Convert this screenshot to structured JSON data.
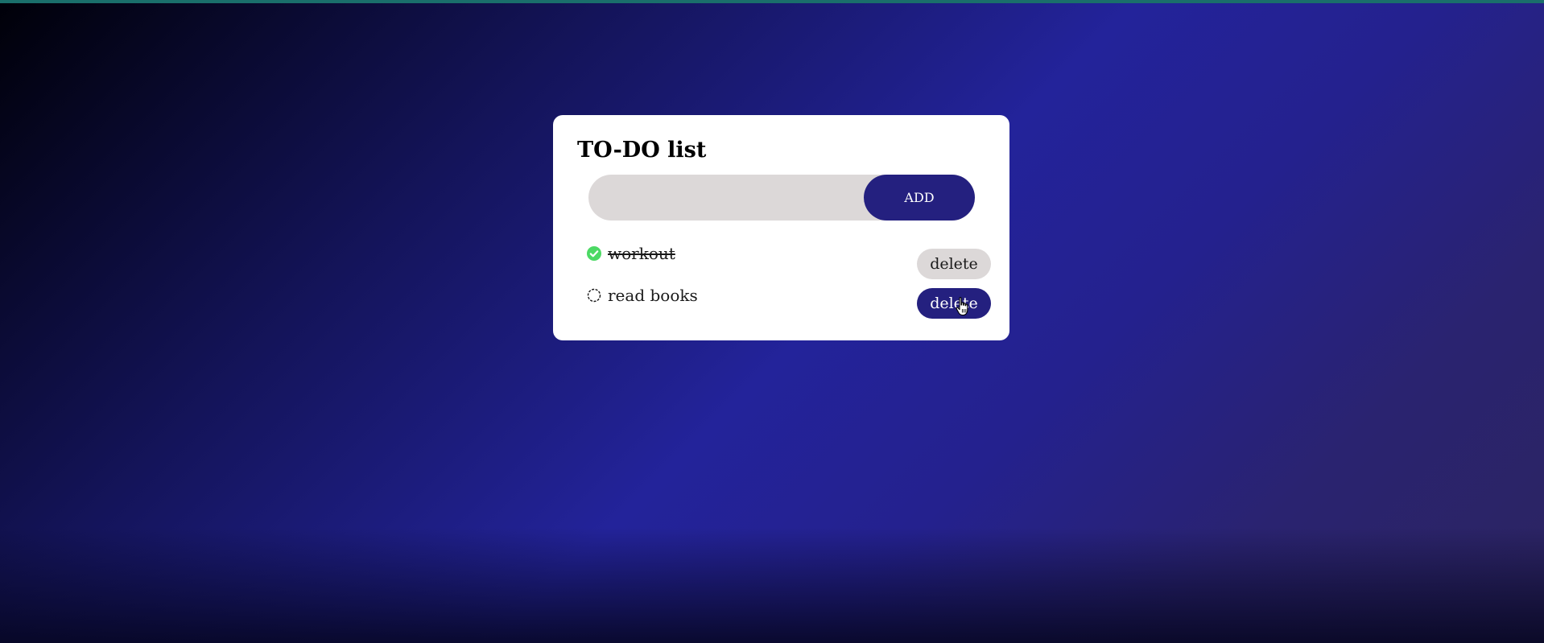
{
  "app": {
    "title": "TO-DO list"
  },
  "add_form": {
    "input_value": "",
    "input_placeholder": "",
    "add_label": "ADD"
  },
  "todos": [
    {
      "text": "workout",
      "done": true,
      "delete_label": "delete",
      "delete_style": "light"
    },
    {
      "text": "read books",
      "done": false,
      "delete_label": "delete",
      "delete_style": "dark-hover"
    }
  ],
  "icons": {
    "checked": "check-circle-icon",
    "unchecked": "empty-circle-icon",
    "pointer": "hand-pointer-icon"
  },
  "colors": {
    "accent": "#24207f",
    "checked_green": "#4cd964",
    "input_bg": "#dcd8d8",
    "top_bar": "#1a6f6b"
  }
}
